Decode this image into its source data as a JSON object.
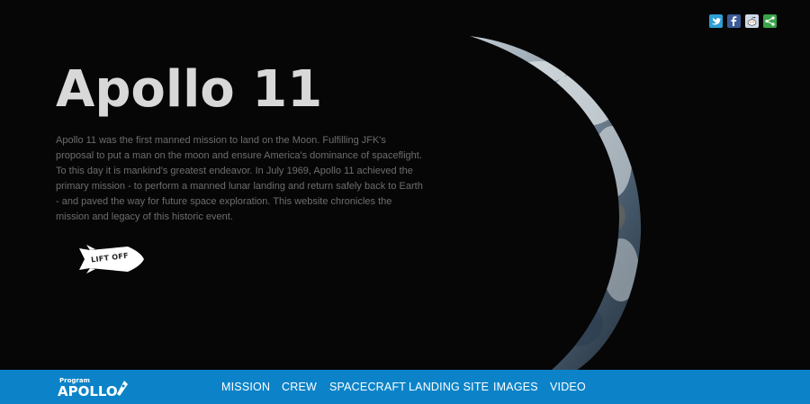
{
  "hero": {
    "title": "Apollo 11",
    "intro": "Apollo 11 was the first manned mission to land on the Moon. Fulfilling JFK's proposal to put a man on the moon and ensure America's dominance of spaceflight. To this day it is mankind's greatest endeavor. In July 1969, Apollo 11 achieved the primary mission - to perform a manned lunar landing and return safely back to Earth - and paved the way for future space exploration. This website chronicles the mission and legacy of this historic event.",
    "liftoff_label": "LIFT OFF"
  },
  "social": {
    "icons": [
      "twitter-icon",
      "facebook-icon",
      "reddit-icon",
      "share-icon"
    ]
  },
  "nav": {
    "logo_small": "Program",
    "logo_big": "APOLLO",
    "items": [
      "MISSION",
      "CREW",
      "SPACECRAFT",
      "LANDING SITE",
      "IMAGES",
      "VIDEO"
    ]
  },
  "colors": {
    "background": "#060606",
    "nav_bar": "#0c83c8",
    "title": "#d8d8d8",
    "intro_text": "#6d6d6d"
  }
}
